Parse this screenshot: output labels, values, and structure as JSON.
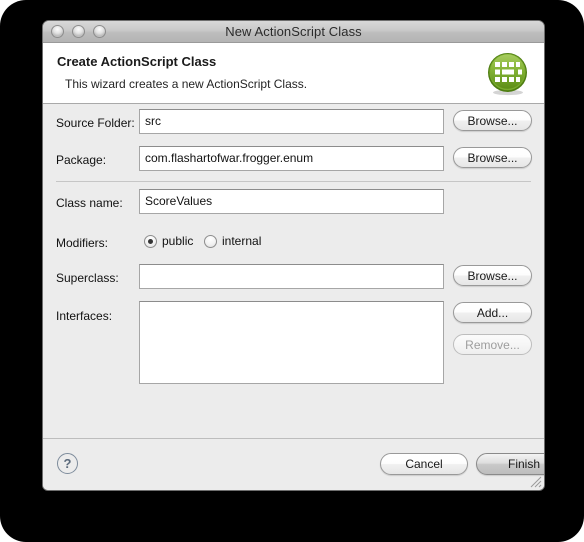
{
  "window": {
    "title": "New ActionScript Class",
    "traffic_lights": [
      "close-button",
      "minimize-button",
      "zoom-button"
    ]
  },
  "header": {
    "title": "Create ActionScript Class",
    "subtitle": "This wizard creates a new ActionScript Class.",
    "icon": "actionscript-class-icon",
    "icon_color": "#6aa023"
  },
  "form": {
    "source_folder": {
      "label": "Source Folder:",
      "value": "src",
      "placeholder": "",
      "button": "Browse..."
    },
    "package": {
      "label": "Package:",
      "value": "com.flashartofwar.frogger.enum",
      "placeholder": "",
      "button": "Browse..."
    },
    "class_name": {
      "label": "Class name:",
      "value": "ScoreValues",
      "placeholder": ""
    },
    "modifiers": {
      "label": "Modifiers:",
      "options": [
        {
          "label": "public",
          "selected": true
        },
        {
          "label": "internal",
          "selected": false
        }
      ]
    },
    "superclass": {
      "label": "Superclass:",
      "value": "",
      "placeholder": "",
      "button": "Browse..."
    },
    "interfaces": {
      "label": "Interfaces:",
      "value": "",
      "add_button": "Add...",
      "remove_button": "Remove...",
      "remove_enabled": false
    }
  },
  "footer": {
    "help_label": "?",
    "cancel_label": "Cancel",
    "finish_label": "Finish",
    "default_button": "Finish"
  }
}
